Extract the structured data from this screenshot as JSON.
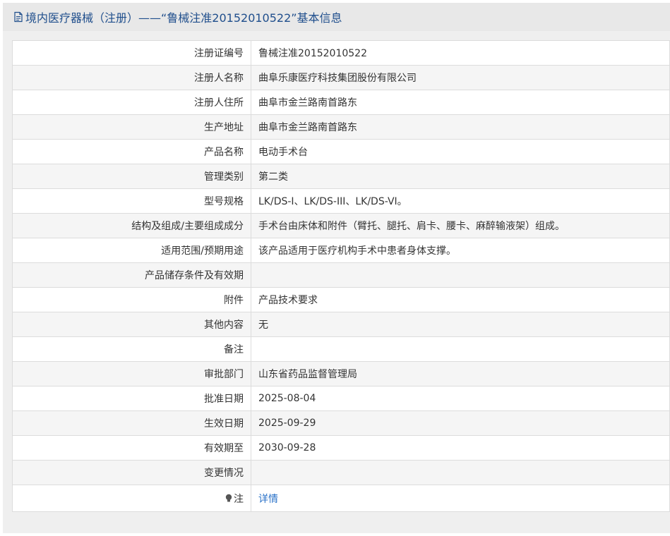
{
  "header": {
    "icon": "document-icon",
    "title": "境内医疗器械（注册）——“鲁械注准20152010522”基本信息"
  },
  "colors": {
    "header_text": "#1f4e8c",
    "link": "#2a72c8",
    "row_alt": "#f5f5f5"
  },
  "rows": [
    {
      "label": "注册证编号",
      "value": "鲁械注准20152010522"
    },
    {
      "label": "注册人名称",
      "value": "曲阜乐康医疗科技集团股份有限公司"
    },
    {
      "label": "注册人住所",
      "value": "曲阜市金兰路南首路东"
    },
    {
      "label": "生产地址",
      "value": "曲阜市金兰路南首路东"
    },
    {
      "label": "产品名称",
      "value": "电动手术台"
    },
    {
      "label": "管理类别",
      "value": "第二类"
    },
    {
      "label": "型号规格",
      "value": "LK/DS-I、LK/DS-III、LK/DS-VI。"
    },
    {
      "label": "结构及组成/主要组成成分",
      "value": "手术台由床体和附件（臂托、腿托、肩卡、腰卡、麻醉输液架）组成。"
    },
    {
      "label": "适用范围/预期用途",
      "value": "该产品适用于医疗机构手术中患者身体支撑。"
    },
    {
      "label": "产品储存条件及有效期",
      "value": ""
    },
    {
      "label": "附件",
      "value": "产品技术要求"
    },
    {
      "label": "其他内容",
      "value": "无"
    },
    {
      "label": "备注",
      "value": ""
    },
    {
      "label": "审批部门",
      "value": "山东省药品监督管理局"
    },
    {
      "label": "批准日期",
      "value": "2025-08-04"
    },
    {
      "label": "生效日期",
      "value": "2025-09-29"
    },
    {
      "label": "有效期至",
      "value": "2030-09-28"
    },
    {
      "label": "变更情况",
      "value": ""
    }
  ],
  "note_row": {
    "icon": "lightbulb-icon",
    "label": "注",
    "link_text": "详情"
  }
}
